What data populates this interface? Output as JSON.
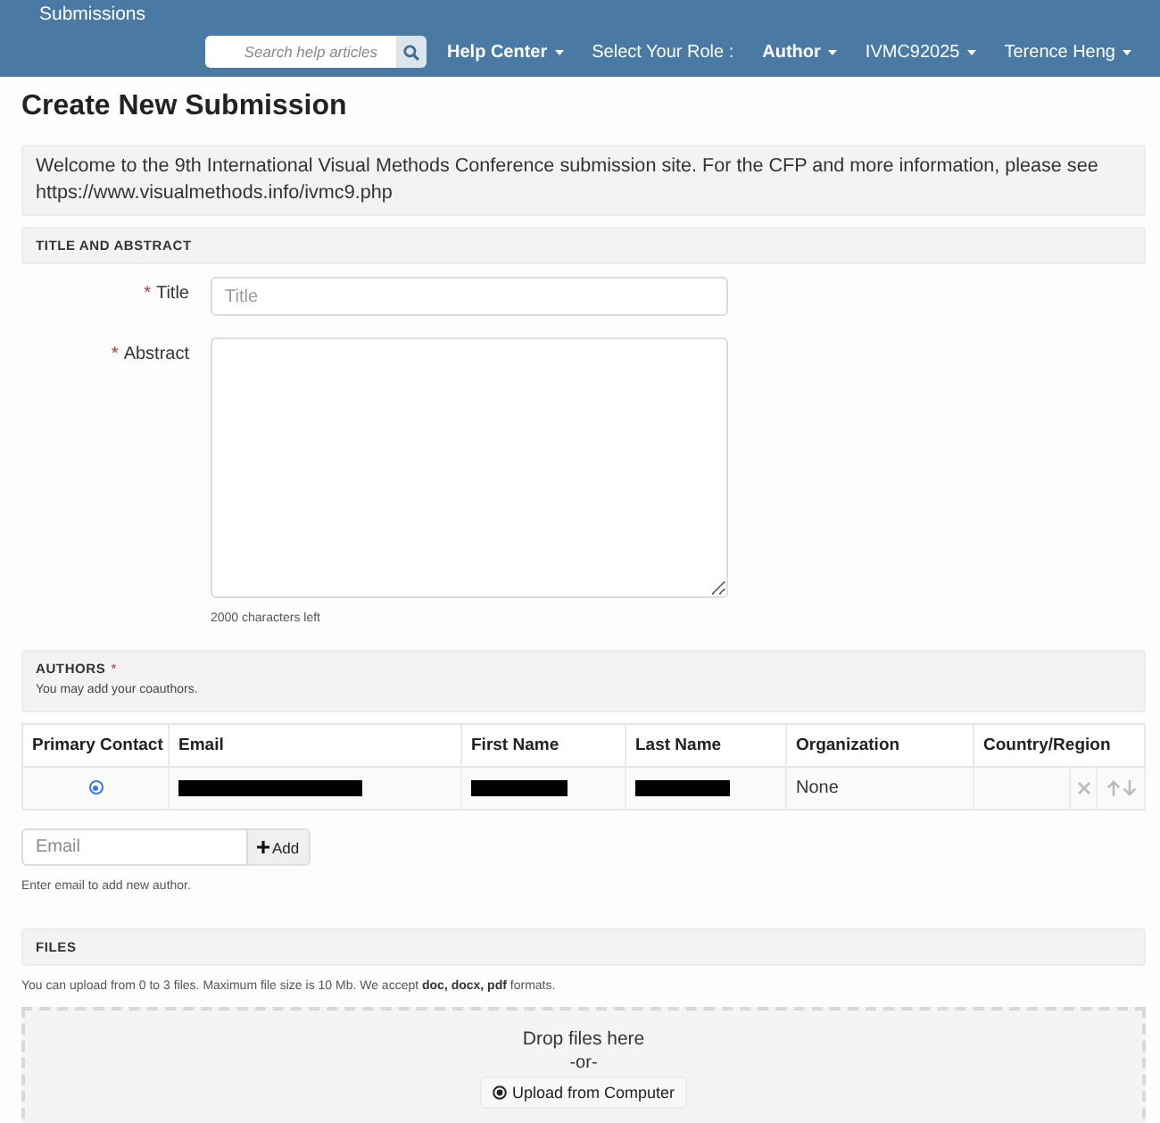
{
  "nav": {
    "title": "Submissions",
    "search": {
      "placeholder": "Search help articles"
    },
    "items": [
      {
        "kind": "dropdown",
        "label": "Help Center",
        "bold": true
      },
      {
        "kind": "text",
        "label": "Select Your Role :",
        "bold": false
      },
      {
        "kind": "dropdown",
        "label": "Author",
        "bold": true
      },
      {
        "kind": "dropdown",
        "label": "IVMC92025",
        "bold": false
      },
      {
        "kind": "dropdown",
        "label": "Terence Heng",
        "bold": false
      }
    ]
  },
  "page_title": "Create New Submission",
  "notice": "Welcome to the 9th International Visual Methods Conference submission site. For the CFP and more information, please see https://www.visualmethods.info/ivmc9.php",
  "title_and_abstract": {
    "heading": "TITLE AND ABSTRACT",
    "fields": [
      {
        "kind": "input",
        "required_mark": "*",
        "label": "Title",
        "placeholder": "Title"
      },
      {
        "kind": "textarea",
        "required_mark": "*",
        "label": "Abstract",
        "help": "2000 characters left"
      }
    ]
  },
  "authors": {
    "heading": "AUTHORS",
    "required_mark": "*",
    "subheading": "You may add your coauthors.",
    "table": {
      "columns": [
        "Primary Contact",
        "Email",
        "First Name",
        "Last Name",
        "Organization",
        "Country/Region"
      ],
      "rows": [
        {
          "cells": [
            {
              "kind": "radio",
              "selected": true
            },
            {
              "kind": "redacted"
            },
            {
              "kind": "redacted"
            },
            {
              "kind": "redacted"
            },
            {
              "kind": "text",
              "text": "None"
            },
            {
              "kind": "empty"
            },
            {
              "kind": "remove"
            },
            {
              "kind": "reorder"
            }
          ]
        }
      ]
    },
    "add": {
      "placeholder": "Email",
      "button": "Add"
    },
    "hint": "Enter email to add new author."
  },
  "files": {
    "heading": "FILES",
    "info": "You can upload from 0 to 3 files. Maximum file size is 10 Mb. We accept **doc, docx, pdf** formats.",
    "dropzone": {
      "title": "Drop files here",
      "separator": "-or-",
      "button": "Upload from Computer"
    }
  }
}
